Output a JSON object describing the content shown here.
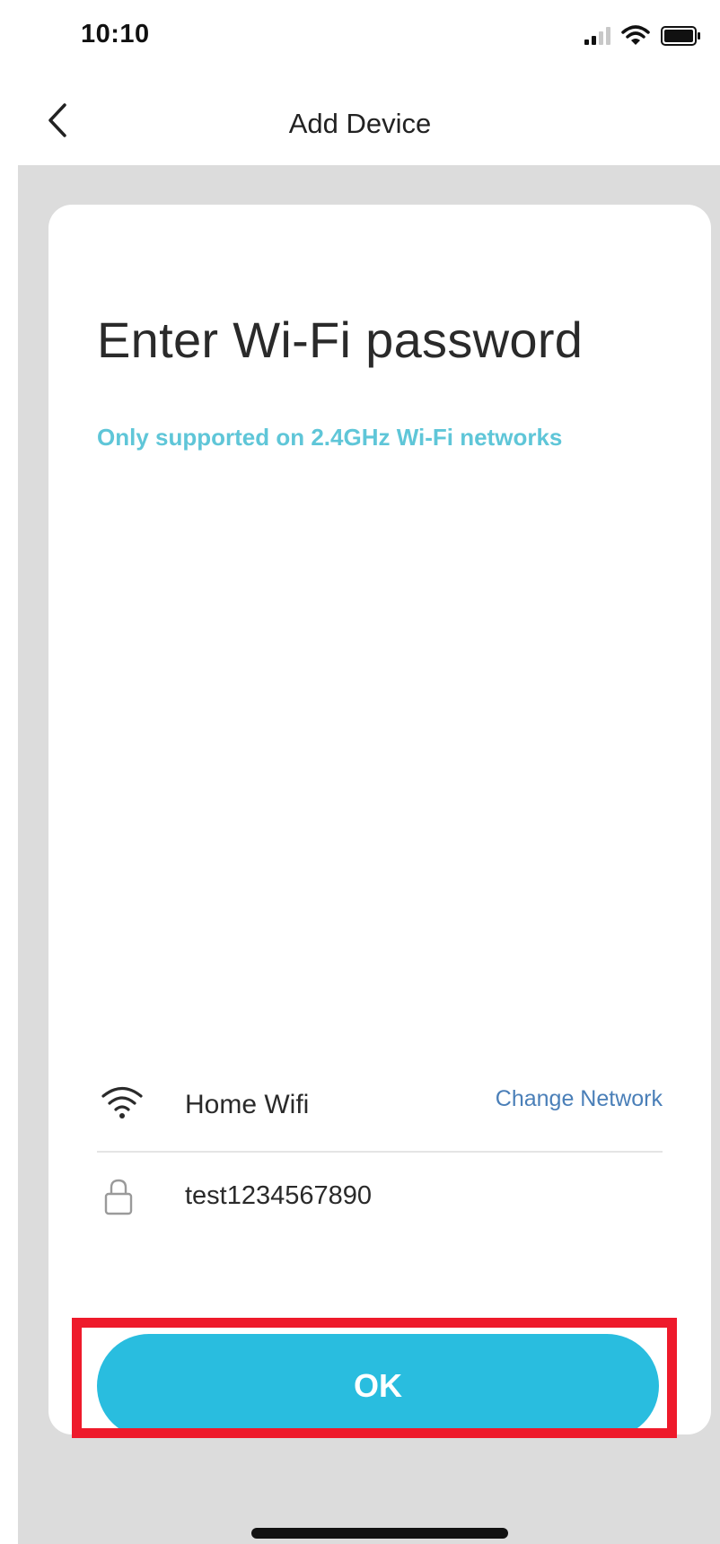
{
  "status_bar": {
    "time": "10:10",
    "icons": [
      "cellular-signal-icon",
      "wifi-signal-icon",
      "battery-icon"
    ]
  },
  "header": {
    "back_icon": "chevron-left-icon",
    "title": "Add Device"
  },
  "main": {
    "title": "Enter Wi-Fi password",
    "subtitle": "Only supported on 2.4GHz Wi-Fi networks",
    "network": {
      "icon": "wifi-icon",
      "name": "Home Wifi",
      "change_label": "Change Network"
    },
    "password": {
      "icon": "lock-icon",
      "value": "test1234567890"
    },
    "ok_label": "OK"
  },
  "colors": {
    "accent": "#29bddf",
    "subtitle": "#5fc6d8",
    "link": "#4a7fb8",
    "highlight": "#ee1a2b",
    "backdrop": "#dcdcdc"
  }
}
